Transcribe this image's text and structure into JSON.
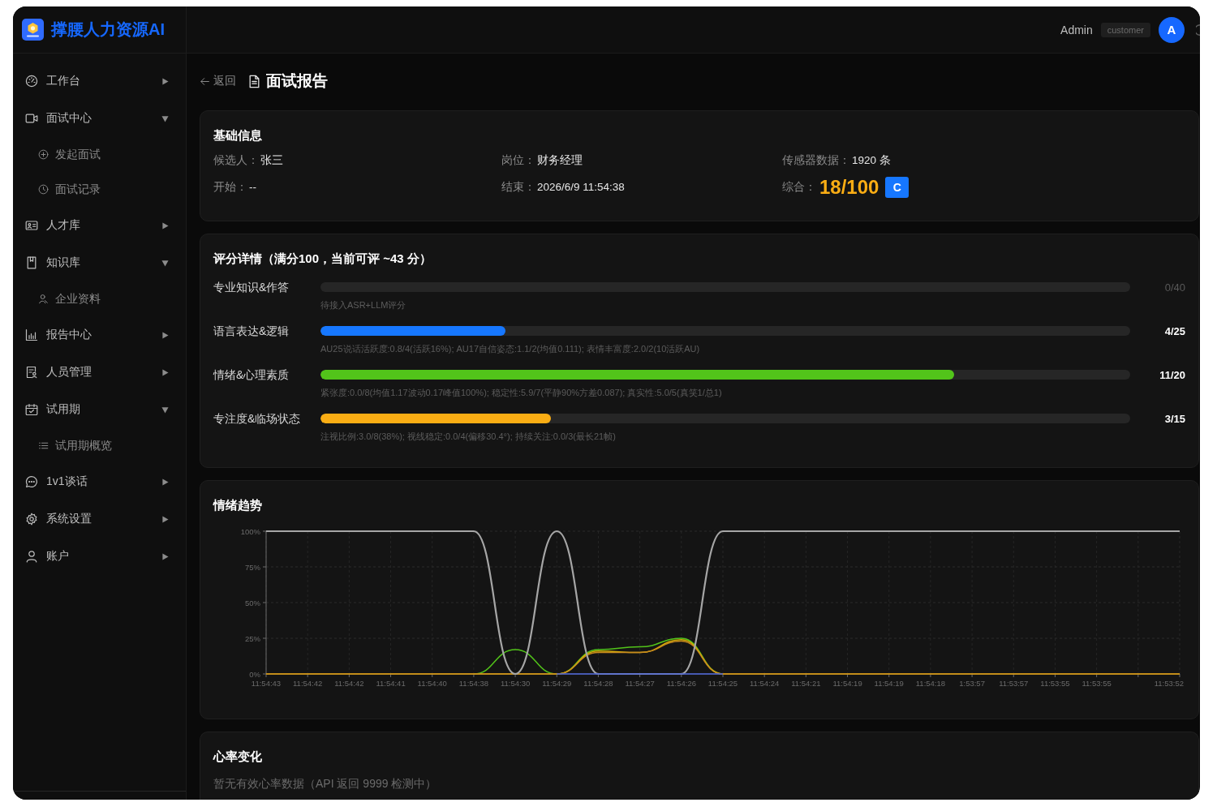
{
  "app": {
    "title": "撑腰人力资源AI"
  },
  "header": {
    "user_name": "Admin",
    "role": "customer",
    "avatar_letter": "A"
  },
  "sidebar": {
    "items": [
      {
        "label": "工作台",
        "expanded": false
      },
      {
        "label": "面试中心",
        "expanded": true,
        "children": [
          {
            "label": "发起面试"
          },
          {
            "label": "面试记录"
          }
        ]
      },
      {
        "label": "人才库",
        "expanded": false
      },
      {
        "label": "知识库",
        "expanded": true,
        "children": [
          {
            "label": "企业资料"
          }
        ]
      },
      {
        "label": "报告中心",
        "expanded": false
      },
      {
        "label": "人员管理",
        "expanded": false
      },
      {
        "label": "试用期",
        "expanded": true,
        "children": [
          {
            "label": "试用期概览"
          }
        ]
      },
      {
        "label": "1v1谈话",
        "expanded": false
      },
      {
        "label": "系统设置",
        "expanded": false
      },
      {
        "label": "账户",
        "expanded": false
      }
    ]
  },
  "page": {
    "back_label": "返回",
    "title": "面试报告"
  },
  "basic_info": {
    "title": "基础信息",
    "fields": [
      {
        "kind": "text",
        "label": "候选人：",
        "content": "张三"
      },
      {
        "kind": "text",
        "label": "岗位：",
        "content": "财务经理"
      },
      {
        "kind": "text",
        "label": "传感器数据：",
        "content": "1920 条"
      },
      {
        "kind": "text",
        "label": "开始：",
        "content": "--"
      },
      {
        "kind": "text",
        "label": "结束：",
        "content": "2026/6/9 11:54:38"
      },
      {
        "kind": "score",
        "label": "综合：",
        "score": "18/100",
        "grade": "C"
      }
    ]
  },
  "score_details": {
    "title": "评分详情（满分100，当前可评 ~43 分）",
    "rows": [
      {
        "kind": "pending",
        "label": "专业知识&作答",
        "score": "0/40",
        "note": "待接入ASR+LLM评分"
      },
      {
        "kind": "scored",
        "label": "语言表达&逻辑",
        "level": 0.228,
        "color": "#1677ff",
        "score": "4/25",
        "note": "AU25说话活跃度:0.8/4(活跃16%); AU17自信姿态:1.1/2(均值0.111); 表情丰富度:2.0/2(10活跃AU)"
      },
      {
        "kind": "scored",
        "label": "情绪&心理素质",
        "level": 0.783,
        "color": "#52c41a",
        "score": "11/20",
        "note": "紧张度:0.0/8(均值1.17波动0.17峰值100%); 稳定性:5.9/7(平静90%方差0.087); 真实性:5.0/5(真笑1/总1)"
      },
      {
        "kind": "scored",
        "label": "专注度&临场状态",
        "level": 0.285,
        "color": "#faad14",
        "score": "3/15",
        "note": "注视比例:3.0/8(38%); 视线稳定:0.0/4(偏移30.4°); 持续关注:0.0/3(最长21帧)"
      }
    ]
  },
  "emotion_trend": {
    "title": "情绪趋势",
    "chart_data": {
      "type": "line",
      "grid": true,
      "categories": [
        "11:54:43",
        "11:54:42",
        "11:54:42",
        "11:54:41",
        "11:54:40",
        "11:54:38",
        "11:54:30",
        "11:54:29",
        "11:54:28",
        "11:54:27",
        "11:54:26",
        "11:54:25",
        "11:54:24",
        "11:54:21",
        "11:54:19",
        "11:54:19",
        "11:54:18",
        "1:53:57",
        "11:53:57",
        "11:53:55",
        "11:53:55",
        null,
        "11:53:52"
      ],
      "ylim": [
        0,
        100
      ],
      "yticks": [
        {
          "value": 0,
          "label": "0%"
        },
        {
          "value": 25,
          "label": "25%"
        },
        {
          "value": 50,
          "label": "50%"
        },
        {
          "value": 75,
          "label": "75%"
        },
        {
          "value": 100,
          "label": "100%"
        }
      ],
      "series": [
        {
          "color": "#4a63d8",
          "values": [
            null,
            null,
            null,
            null,
            null,
            null,
            null,
            0,
            0,
            0,
            0,
            0,
            null,
            null,
            null,
            null,
            null,
            null,
            null,
            null,
            null,
            null,
            null
          ]
        },
        {
          "color": "#52c41a",
          "values": [
            null,
            null,
            null,
            null,
            null,
            0,
            17,
            0,
            17,
            19,
            25,
            0,
            null,
            null,
            null,
            null,
            null,
            null,
            null,
            null,
            null,
            null,
            null
          ]
        },
        {
          "color": "#d4b106",
          "values": [
            0,
            0,
            0,
            0,
            0,
            0,
            0,
            0,
            16,
            15,
            24,
            0,
            0,
            0,
            0,
            0,
            0,
            0,
            0,
            0,
            0,
            0,
            0
          ]
        },
        {
          "color": "#c98a1e",
          "values": [
            0,
            0,
            0,
            0,
            0,
            0,
            0,
            0,
            15,
            15,
            23,
            0,
            0,
            0,
            0,
            0,
            0,
            0,
            0,
            0,
            0,
            0,
            0
          ]
        },
        {
          "color": "#a6a6a6",
          "values": [
            100,
            100,
            100,
            100,
            100,
            100,
            0,
            100,
            0,
            0,
            0,
            100,
            100,
            100,
            100,
            100,
            100,
            100,
            100,
            100,
            100,
            100,
            100
          ]
        }
      ]
    }
  },
  "heart_rate": {
    "title": "心率变化",
    "message": "暂无有效心率数据（API 返回 9999 检测中）"
  }
}
